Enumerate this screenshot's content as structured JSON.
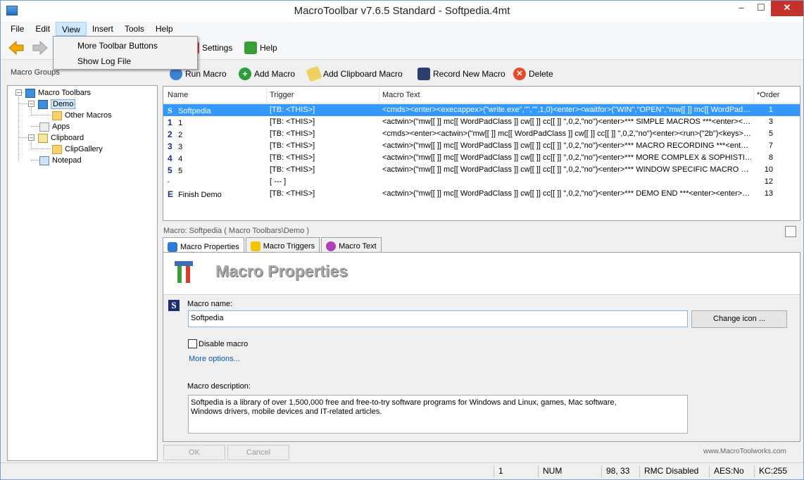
{
  "window": {
    "title": "MacroToolbar v7.6.5 Standard - Softpedia.4mt",
    "minimize": "–",
    "maximize": "☐",
    "close": "✕"
  },
  "menu": [
    "File",
    "Edit",
    "View",
    "Insert",
    "Tools",
    "Help"
  ],
  "view_menu": {
    "items": [
      "More Toolbar Buttons",
      "Show Log File"
    ]
  },
  "toolbar1": {
    "settings": "Settings",
    "help": "Help"
  },
  "left_panel": {
    "label": "Macro Groups",
    "tree": [
      {
        "label": "Macro Toolbars"
      },
      {
        "label": "Demo"
      },
      {
        "label": "Other Macros"
      },
      {
        "label": "Apps"
      },
      {
        "label": "Clipboard"
      },
      {
        "label": "ClipGallery"
      },
      {
        "label": "Notepad"
      }
    ]
  },
  "toolbar2": {
    "run": "Run Macro",
    "add": "Add Macro",
    "add_clip": "Add Clipboard Macro",
    "record": "Record New Macro",
    "delete": "Delete"
  },
  "grid": {
    "headers": {
      "name": "Name",
      "trigger": "Trigger",
      "text": "Macro Text",
      "order": "*Order"
    },
    "rows": [
      {
        "badge": "S",
        "name": "Softpedia",
        "trigger": "[TB: <THIS>]",
        "text": "<cmds><enter><execappex>(\"write.exe\",\"\",\"\",1,0)<enter><waitfor>(\"WIN\",\"OPEN\",\"mw[[ ]] mc[[ WordPad…",
        "order": "1"
      },
      {
        "badge": "1",
        "name": "1",
        "trigger": "[TB: <THIS>]",
        "text": "<actwin>(\"mw[[  ]] mc[[ WordPadClass ]] cw[[  ]] cc[[  ]] \",0,2,\"no\")<enter>*** SIMPLE MACROS ***<enter><…",
        "order": "3"
      },
      {
        "badge": "2",
        "name": "2",
        "trigger": "[TB: <THIS>]",
        "text": "<cmds><enter><actwin>(\"mw[[  ]] mc[[ WordPadClass ]] cw[[  ]] cc[[  ]] \",0,2,\"no\")<enter><run>(\"2b\")<keys>…",
        "order": "5"
      },
      {
        "badge": "3",
        "name": "3",
        "trigger": "[TB: <THIS>]",
        "text": "<actwin>(\"mw[[  ]] mc[[ WordPadClass ]] cw[[  ]] cc[[  ]] \",0,2,\"no\")<enter>*** MACRO RECORDING ***<ent…",
        "order": "7"
      },
      {
        "badge": "4",
        "name": "4",
        "trigger": "[TB: <THIS>]",
        "text": "<actwin>(\"mw[[  ]] mc[[ WordPadClass ]] cw[[  ]] cc[[  ]] \",0,2,\"no\")<enter>*** MORE COMPLEX & SOPHISTI…",
        "order": "8"
      },
      {
        "badge": "5",
        "name": "5",
        "trigger": "[TB: <THIS>]",
        "text": "<actwin>(\"mw[[  ]] mc[[ WordPadClass ]] cw[[  ]] cc[[  ]] \",0,2,\"no\")<enter>*** WINDOW SPECIFIC MACRO …",
        "order": "10"
      },
      {
        "badge": "-",
        "name": "",
        "trigger": "[ --- ]",
        "text": "",
        "order": "12"
      },
      {
        "badge": "E",
        "name": "Finish Demo",
        "trigger": "[TB: <THIS>]",
        "text": "<actwin>(\"mw[[  ]] mc[[ WordPadClass ]] cw[[  ]] cc[[  ]] \",0,2,\"no\")<enter>*** DEMO END ***<enter><enter>…",
        "order": "13"
      }
    ]
  },
  "detail": {
    "caption": "Macro: Softpedia ( Macro Toolbars\\Demo )",
    "tabs": [
      "Macro Properties",
      "Macro Triggers",
      "Macro Text"
    ],
    "title": "Macro Properties",
    "name_label": "Macro name:",
    "name_value": "Softpedia",
    "change_icon": "Change icon ...",
    "disable_label": "Disable macro",
    "more_options": "More options...",
    "desc_label": "Macro description:",
    "desc_value": "Softpedia is a library of over 1,500,000 free and free-to-try software programs for Windows and Linux, games, Mac software,\nWindows drivers, mobile devices and IT-related articles.",
    "ok": "OK",
    "cancel": "Cancel",
    "website": "www.MacroToolworks.com"
  },
  "statusbar": {
    "count": "1",
    "num": "NUM",
    "coords": "98,  33",
    "rmc": "RMC Disabled",
    "aes": "AES:No",
    "kc": "KC:255"
  },
  "colors": {
    "selection": "#3399ff",
    "badge": "#1a2f8a",
    "close_button": "#c7312b",
    "link": "#0c55b2"
  }
}
